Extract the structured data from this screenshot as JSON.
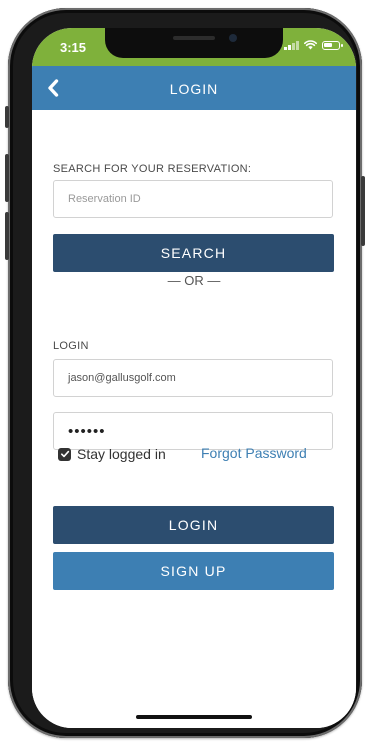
{
  "status_bar": {
    "time": "3:15",
    "background_color": "#7fb13b"
  },
  "nav": {
    "title": "LOGIN",
    "back_icon": "chevron-left-icon",
    "background_color": "#3d7fb3"
  },
  "reservation": {
    "section_label": "SEARCH FOR YOUR RESERVATION:",
    "id_placeholder": "Reservation ID",
    "search_label": "SEARCH"
  },
  "divider": {
    "text": "— OR —"
  },
  "login": {
    "section_label": "LOGIN",
    "email_value": "jason@gallusgolf.com",
    "password_value": "••••••",
    "stay_logged_in_label": "Stay logged in",
    "stay_logged_in_checked": true,
    "forgot_password_label": "Forgot Password",
    "login_label": "LOGIN",
    "signup_label": "SIGN UP"
  },
  "colors": {
    "primary_dark": "#2c4d6f",
    "primary_light": "#3d7fb3",
    "link": "#3d7fb3"
  }
}
